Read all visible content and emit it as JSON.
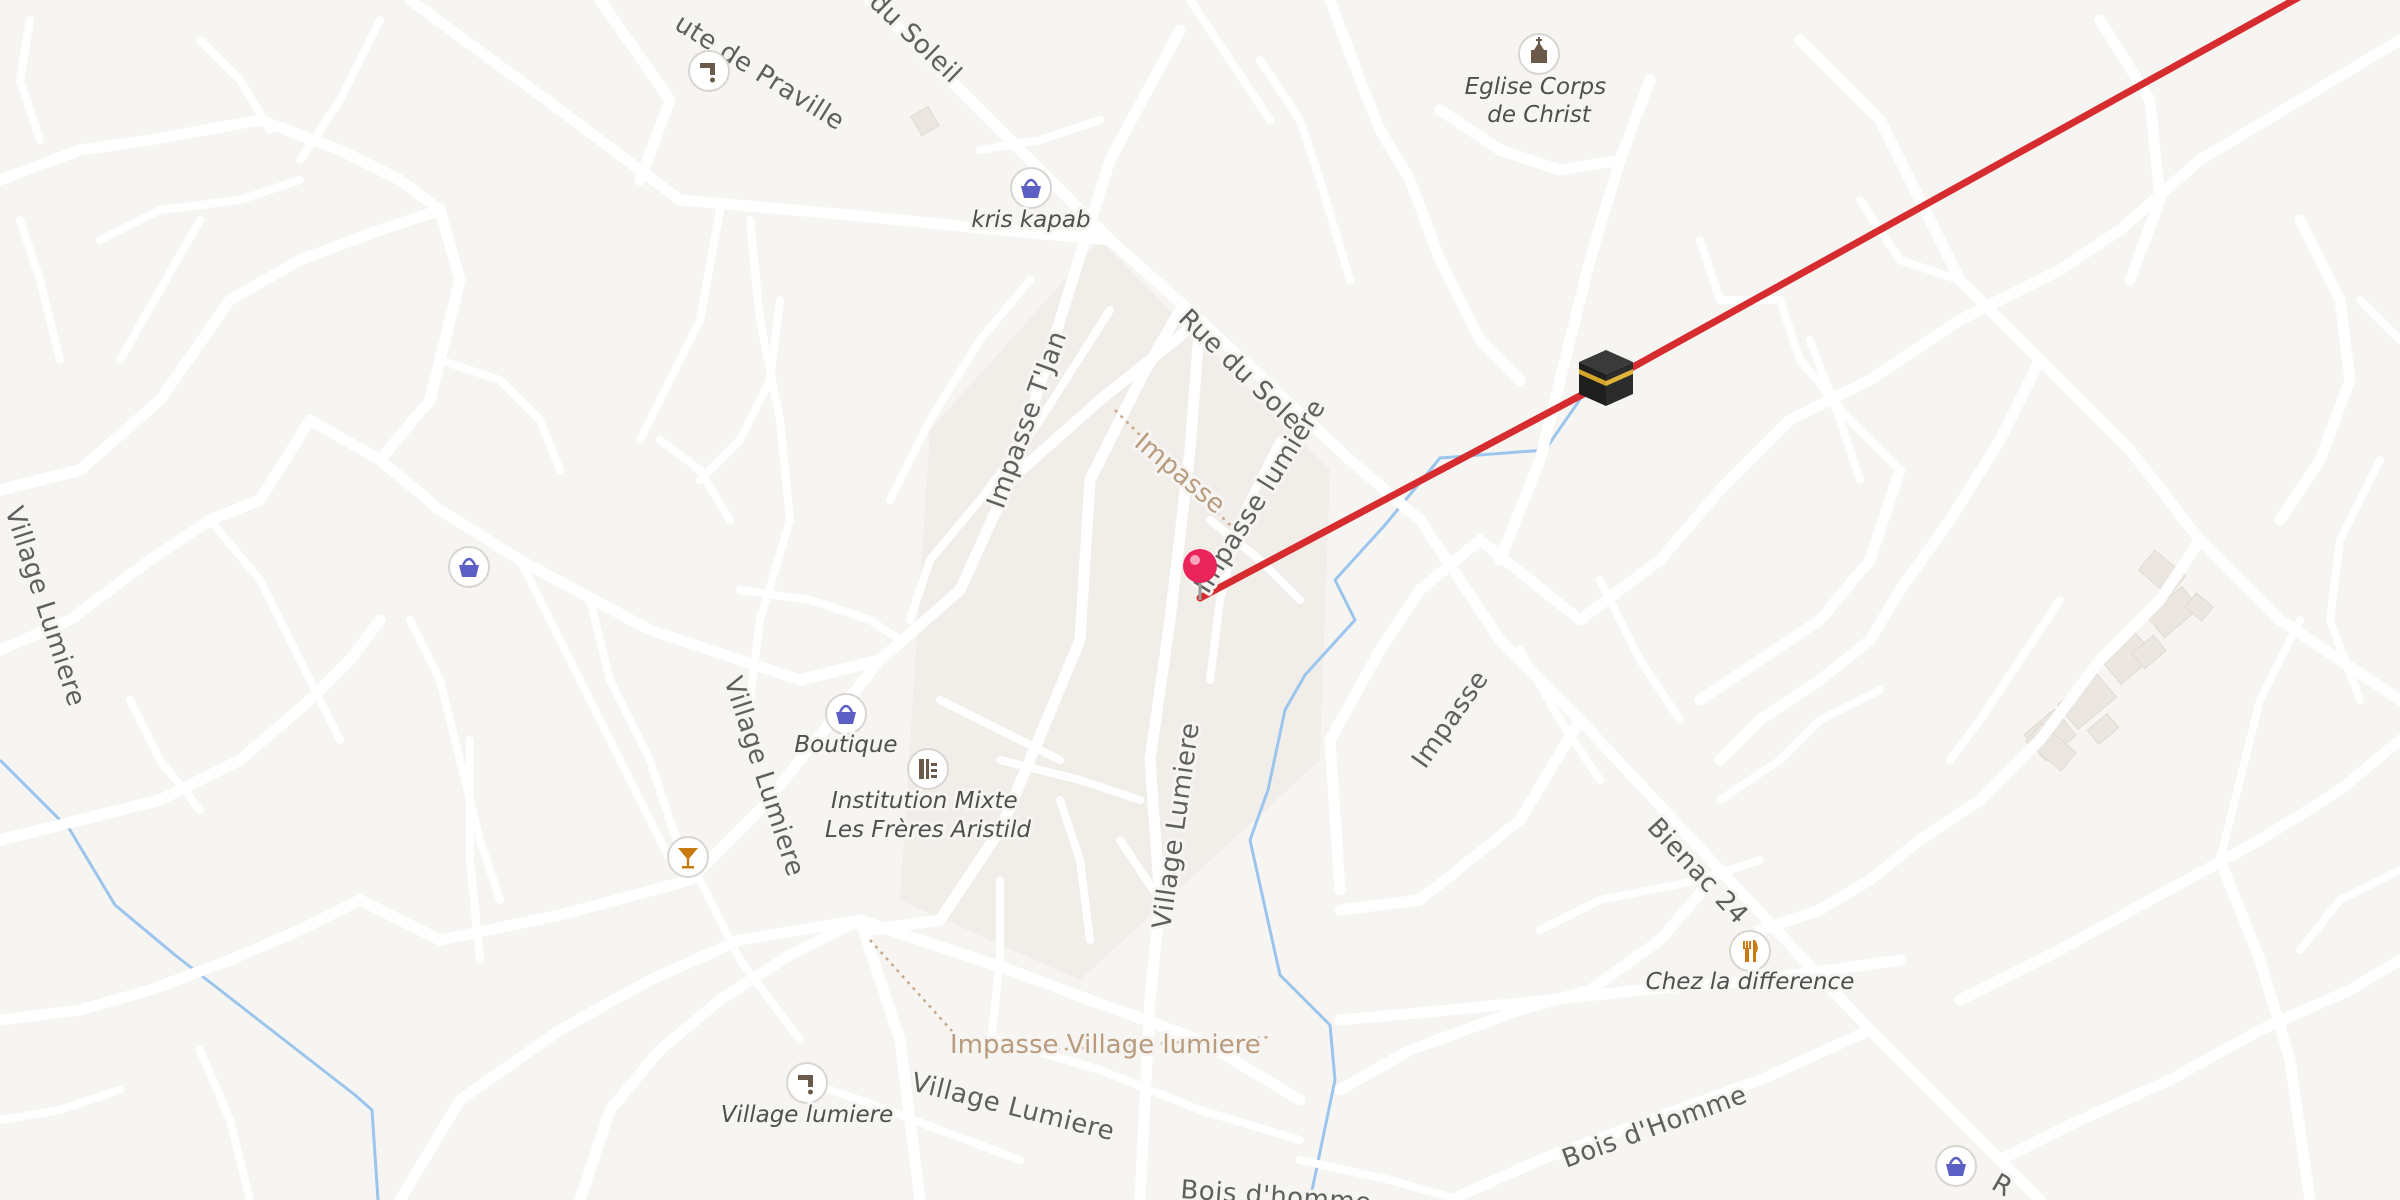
{
  "streets": {
    "rue_du_soleil": "Rue du Soleil",
    "rue_du_soleil_top": "du Soleil",
    "route_de_praville": "ute de Praville",
    "impasse_tjan": "Impasse T'Jan",
    "impasse_lumiere": "Impasse lumiere",
    "village_lumiere_left": "Village Lumiere",
    "village_lumiere_mid": "Village Lumiere",
    "village_lumiere_center": "Village Lumiere",
    "village_lumiere_bottom": "Village Lumiere",
    "impasse_east": "Impasse",
    "bienac_24": "Bienac 24",
    "bois_dhomme": "Bois d'Homme",
    "bois_dhomme_bottom": "Bois d'homme",
    "bottom_right_fragment": "R"
  },
  "paths": {
    "impasse_dotted": "Impasse",
    "impasse_village_lumiere": "Impasse Village lumiere"
  },
  "pois": {
    "eglise": "Eglise Corps\nde Christ",
    "kris_kapab": "kris kapab",
    "boutique": "Boutique",
    "institution": "Institution Mixte\nLes Frères Aristild",
    "chez_la_difference": "Chez la difference",
    "village_lumiere_tap": "Village lumiere"
  },
  "icons": {
    "church": "church-icon",
    "shop": "shopping-basket-icon",
    "water_tap": "water-tap-icon",
    "school": "school-icon",
    "bar": "cocktail-icon",
    "restaurant": "fork-knife-icon",
    "kaaba": "kaaba-icon",
    "location_pin": "location-pin-icon"
  },
  "colors": {
    "background": "#f7f5f2",
    "road": "#ffffff",
    "route_line": "#d62b2f",
    "stream": "#9cc5ee",
    "pin": "#e8245a",
    "shop_icon": "#5c5fc4",
    "amenity_icon": "#c97b12"
  }
}
